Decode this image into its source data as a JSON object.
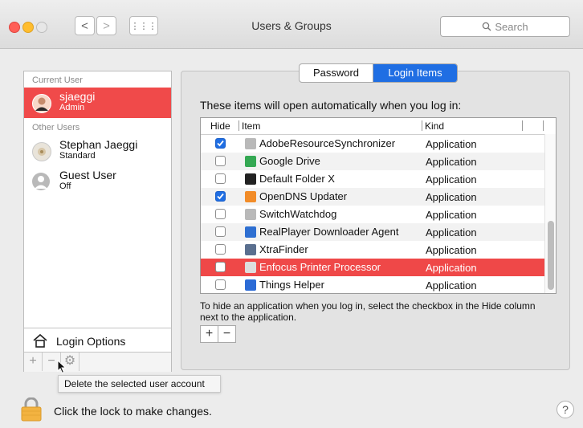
{
  "window": {
    "title": "Users & Groups",
    "search_placeholder": "Search"
  },
  "toolbar": {
    "back_glyph": "<",
    "forward_glyph": ">",
    "grid_glyph": "⋮⋮⋮"
  },
  "sidebar": {
    "current_user_header": "Current User",
    "current_user": {
      "name": "sjaeggi",
      "role": "Admin"
    },
    "other_users_header": "Other Users",
    "other_users": [
      {
        "name": "Stephan Jaeggi",
        "role": "Standard"
      },
      {
        "name": "Guest User",
        "role": "Off"
      }
    ],
    "login_options": "Login Options",
    "buttons": {
      "add": "+",
      "remove": "−",
      "action": "⚙"
    }
  },
  "tooltip": "Delete the selected user account",
  "tabs": {
    "password": "Password",
    "login_items": "Login Items",
    "active": "Login Items"
  },
  "login_items": {
    "intro": "These items will open automatically when you log in:",
    "columns": {
      "hide": "Hide",
      "item": "Item",
      "kind": "Kind"
    },
    "rows": [
      {
        "checked": true,
        "name": "AdobeResourceSynchronizer",
        "kind": "Application",
        "icon_color": "#b9b9b9"
      },
      {
        "checked": false,
        "name": "Google Drive",
        "kind": "Application",
        "icon_color": "#34a853"
      },
      {
        "checked": false,
        "name": "Default Folder X",
        "kind": "Application",
        "icon_color": "#222222"
      },
      {
        "checked": true,
        "name": "OpenDNS Updater",
        "kind": "Application",
        "icon_color": "#f28c28"
      },
      {
        "checked": false,
        "name": "SwitchWatchdog",
        "kind": "Application",
        "icon_color": "#b9b9b9"
      },
      {
        "checked": false,
        "name": "RealPlayer Downloader Agent",
        "kind": "Application",
        "icon_color": "#2e6fd1"
      },
      {
        "checked": false,
        "name": "XtraFinder",
        "kind": "Application",
        "icon_color": "#5a6f8f"
      },
      {
        "checked": false,
        "name": "Enfocus Printer Processor",
        "kind": "Application",
        "icon_color": "#dddddd",
        "selected": true
      },
      {
        "checked": false,
        "name": "Things Helper",
        "kind": "Application",
        "icon_color": "#2c6bd6"
      }
    ],
    "hint": "To hide an application when you log in, select the checkbox in the Hide column next to the application.",
    "add_button": "+",
    "remove_button": "−"
  },
  "footer": {
    "lock_text": "Click the lock to make changes.",
    "help": "?"
  },
  "colors": {
    "accent": "#1f6ee3",
    "selection_red": "#ef4848"
  }
}
